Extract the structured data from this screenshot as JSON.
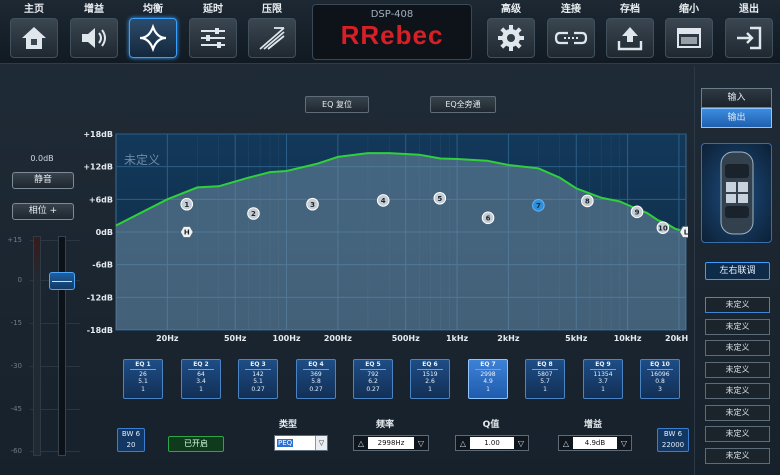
{
  "toolbar": {
    "buttons": [
      {
        "label": "主页",
        "icon": "home-icon"
      },
      {
        "label": "增益",
        "icon": "speaker-icon"
      },
      {
        "label": "均衡",
        "icon": "eq-diamond-icon"
      },
      {
        "label": "延时",
        "icon": "sliders-icon"
      },
      {
        "label": "压限",
        "icon": "limiter-icon"
      },
      {
        "label": "高级",
        "icon": "gear-icon"
      },
      {
        "label": "连接",
        "icon": "link-icon"
      },
      {
        "label": "存档",
        "icon": "upload-icon"
      },
      {
        "label": "缩小",
        "icon": "window-icon"
      },
      {
        "label": "退出",
        "icon": "exit-icon"
      }
    ],
    "active": "均衡",
    "device_model": "DSP-408",
    "brand": "Rebec",
    "brand_prefix_color": "#d61f26"
  },
  "left": {
    "gain_readout": "0.0dB",
    "mute_label": "静音",
    "phase_label": "相位 +",
    "scale": [
      "+15",
      "0",
      "-15",
      "-30",
      "-45",
      "-60"
    ]
  },
  "eq": {
    "reset_label": "EQ 复位",
    "bypass_label": "EQ全旁通",
    "preset_name": "未定义"
  },
  "chart_data": {
    "type": "line",
    "title": "",
    "xscale": "log",
    "xlim": [
      10,
      22000
    ],
    "ylim": [
      -18,
      18
    ],
    "x_ticks": [
      "20Hz",
      "50Hz",
      "100Hz",
      "200Hz",
      "500Hz",
      "1kHz",
      "2kHz",
      "5kHz",
      "10kHz",
      "20kHz"
    ],
    "x_tick_values": [
      20,
      50,
      100,
      200,
      500,
      1000,
      2000,
      5000,
      10000,
      20000
    ],
    "y_ticks": [
      "+18dB",
      "+12dB",
      "+6dB",
      "0dB",
      "-6dB",
      "-12dB",
      "-18dB"
    ],
    "y_tick_values": [
      18,
      12,
      6,
      0,
      -6,
      -12,
      -18
    ],
    "curve_color": "#2fd03a",
    "curve": {
      "x": [
        10,
        20,
        30,
        40,
        60,
        80,
        100,
        150,
        200,
        300,
        400,
        600,
        800,
        1000,
        1500,
        2000,
        3000,
        4000,
        5000,
        7000,
        9000,
        11000,
        13000,
        15000,
        17000,
        19000,
        22000
      ],
      "y": [
        1.2,
        6,
        8.2,
        8.4,
        10,
        11,
        11.2,
        12.5,
        13.8,
        14.5,
        14.5,
        14.2,
        13.5,
        13.4,
        13.1,
        12.3,
        11.7,
        10,
        8,
        6.3,
        5.6,
        4.4,
        3.5,
        2.2,
        1.5,
        0.6,
        0
      ]
    },
    "bands": [
      {
        "label": "H",
        "freq": 26,
        "gain": 0
      },
      {
        "label": "1",
        "freq": 26,
        "gain": 5.1
      },
      {
        "label": "2",
        "freq": 64,
        "gain": 3.4
      },
      {
        "label": "3",
        "freq": 142,
        "gain": 5.1
      },
      {
        "label": "4",
        "freq": 369,
        "gain": 5.8
      },
      {
        "label": "5",
        "freq": 792,
        "gain": 6.2
      },
      {
        "label": "6",
        "freq": 1519,
        "gain": 2.6
      },
      {
        "label": "7",
        "freq": 2998,
        "gain": 4.9
      },
      {
        "label": "8",
        "freq": 5807,
        "gain": 5.7
      },
      {
        "label": "9",
        "freq": 11354,
        "gain": 3.7
      },
      {
        "label": "10",
        "freq": 16096,
        "gain": 0.8
      },
      {
        "label": "L",
        "freq": 22000,
        "gain": 0
      }
    ]
  },
  "bands": [
    {
      "title": "EQ 1",
      "freq": "26",
      "gain": "5.1",
      "q": "1"
    },
    {
      "title": "EQ 2",
      "freq": "64",
      "gain": "3.4",
      "q": "1"
    },
    {
      "title": "EQ 3",
      "freq": "142",
      "gain": "5.1",
      "q": "0.27"
    },
    {
      "title": "EQ 4",
      "freq": "369",
      "gain": "5.8",
      "q": "0.27"
    },
    {
      "title": "EQ 5",
      "freq": "792",
      "gain": "6.2",
      "q": "0.27"
    },
    {
      "title": "EQ 6",
      "freq": "1519",
      "gain": "2.6",
      "q": "1"
    },
    {
      "title": "EQ 7",
      "freq": "2998",
      "gain": "4.9",
      "q": "1"
    },
    {
      "title": "EQ 8",
      "freq": "5807",
      "gain": "5.7",
      "q": "1"
    },
    {
      "title": "EQ 9",
      "freq": "11354",
      "gain": "3.7",
      "q": "1"
    },
    {
      "title": "EQ 10",
      "freq": "16096",
      "gain": "0.8",
      "q": "3"
    }
  ],
  "selected_band": "EQ 7",
  "bottom": {
    "bw_left_label": "BW 6",
    "bw_left_value": "20",
    "bw_right_label": "BW 6",
    "bw_right_value": "22000",
    "enabled_label": "已开启",
    "type_label": "类型",
    "type_value": "PEQ",
    "freq_label": "频率",
    "freq_value": "2998Hz",
    "q_label": "Q值",
    "q_value": "1.00",
    "gain_label": "增益",
    "gain_value": "4.9dB"
  },
  "right": {
    "input_label": "输入",
    "output_label": "输出",
    "selected": "输出",
    "link_label": "左右联调",
    "presets": [
      "未定义",
      "未定义",
      "未定义",
      "未定义",
      "未定义",
      "未定义",
      "未定义",
      "未定义"
    ]
  }
}
